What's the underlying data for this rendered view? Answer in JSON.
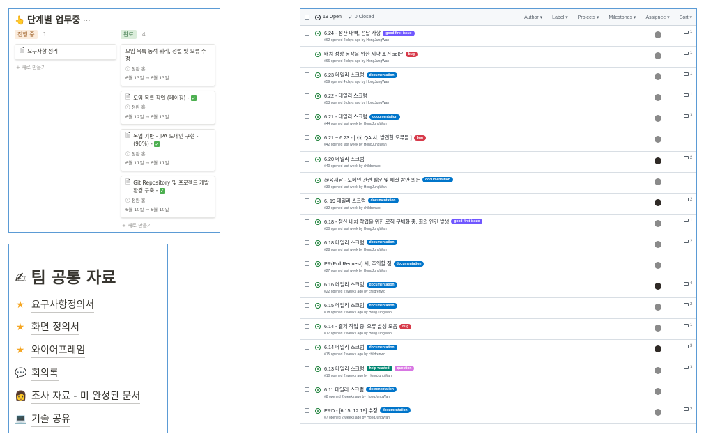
{
  "kanban": {
    "title": "단계별 업무중",
    "title_icon": "pointer-hand-icon",
    "more": "···",
    "columns": [
      {
        "tag": "진행 중",
        "count": "1",
        "cards": [
          {
            "title": "요구사항 정리",
            "done": false
          }
        ],
        "new_label": "+ 새로 만들기"
      },
      {
        "tag": "완료",
        "count": "4",
        "cards": [
          {
            "title": "모임 목록 동적 쿼리, 정렬 및 오류 수정",
            "person": "정완 홍",
            "dates": "6월 13일 → 6월 13일",
            "done": false,
            "has_icon": false
          },
          {
            "title": "모임 목록 작업 (페이징) -",
            "person": "정완 홍",
            "dates": "6월 12일 → 6월 13일",
            "done": true,
            "has_icon": true
          },
          {
            "title": "목업 기반 - JPA 도메인 구현 - (90%) -",
            "person": "정완 홍",
            "dates": "6월 11일 → 6월 11일",
            "done": true,
            "has_icon": true
          },
          {
            "title": "Git Repository 및 프로젝트 개발 환경 구축 -",
            "person": "정완 홍",
            "dates": "6월 10일 → 6월 10일",
            "done": true,
            "has_icon": true
          }
        ],
        "new_label": "+ 새로 만들기"
      }
    ]
  },
  "team": {
    "title": "팀 공통 자료",
    "title_icon": "writing-hand-icon",
    "items": [
      {
        "label": "요구사항정의서",
        "icon": "star-icon"
      },
      {
        "label": "화면 정의서",
        "icon": "star-icon"
      },
      {
        "label": "와이어프레임",
        "icon": "star-icon"
      },
      {
        "label": "회의록",
        "icon": "speech-bubble-icon"
      },
      {
        "label": "조사 자료 - 미 완성된 문서",
        "icon": "person-at-desk-icon"
      },
      {
        "label": "기술 공유",
        "icon": "laptop-icon"
      }
    ]
  },
  "issues": {
    "open_label": "19 Open",
    "closed_label": "0 Closed",
    "filters": [
      "Author ▾",
      "Label ▾",
      "Projects ▾",
      "Milestones ▾",
      "Assignee ▾",
      "Sort ▾"
    ],
    "label_colors": {
      "good first issue": "#7057ff",
      "bug": "#d73a4a",
      "documentation": "#0075ca",
      "help wanted": "#008672",
      "question": "#d876e3"
    },
    "rows": [
      {
        "title": "6.24 - 정산 내역, 전달 사항",
        "labels": [
          "good first issue"
        ],
        "sub": "#62 opened 2 days ago by HongJungWan",
        "comments": "1",
        "avatar_dark": false
      },
      {
        "title": "배치 정상 동작을 위한 제약 조건 sql문",
        "labels": [
          "bug"
        ],
        "sub": "#66 opened 2 days ago by HongJungWan",
        "comments": "1",
        "avatar_dark": false
      },
      {
        "title": "6.23 데일리 스크럼",
        "labels": [
          "documentation"
        ],
        "sub": "#59 opened 4 days ago by HongJungWan",
        "comments": "1",
        "avatar_dark": false
      },
      {
        "title": "6.22 - 데일리 스크럼",
        "labels": [],
        "sub": "#53 opened 5 days ago by HongJungWan",
        "comments": "1",
        "avatar_dark": false
      },
      {
        "title": "6.21 - 데일리 스크럼",
        "labels": [
          "documentation"
        ],
        "sub": "#44 opened last week by HongJungWan",
        "comments": "3",
        "avatar_dark": false
      },
      {
        "title": "6.21 ~ 6.23 - [ 👀 QA 시, 발견한 오류들 ]",
        "labels": [
          "bug"
        ],
        "sub": "#42 opened last week by HongJungWan",
        "comments": "",
        "avatar_dark": false
      },
      {
        "title": "6.20 데일리 스크럼",
        "labels": [],
        "sub": "#40 opened last week by childrenwo",
        "comments": "2",
        "avatar_dark": true
      },
      {
        "title": "@육재남 - 도메인 관련 질문 및 해결 방안 의논",
        "labels": [
          "documentation"
        ],
        "sub": "#39 opened last week by HongJungWan",
        "comments": "",
        "avatar_dark": false
      },
      {
        "title": "6. 19 데일리 스크럼",
        "labels": [
          "documentation"
        ],
        "sub": "#32 opened last week by childrenwo",
        "comments": "2",
        "avatar_dark": true
      },
      {
        "title": "6.18 - 정산 배치 작업을 위한 로직 구체화 중, 회의 안건 발생",
        "labels": [
          "good first issue"
        ],
        "sub": "#30 opened last week by HongJungWan",
        "comments": "1",
        "avatar_dark": false
      },
      {
        "title": "6.18 데일리 스크럼",
        "labels": [
          "documentation"
        ],
        "sub": "#28 opened last week by HongJungWan",
        "comments": "2",
        "avatar_dark": false
      },
      {
        "title": "PR(Pull Request) 시, 주의할 점",
        "labels": [
          "documentation"
        ],
        "sub": "#27 opened last week by HongJungWan",
        "comments": "",
        "avatar_dark": false
      },
      {
        "title": "6.16 데일리 스크럼",
        "labels": [
          "documentation"
        ],
        "sub": "#22 opened 2 weeks ago by childrenwo",
        "comments": "4",
        "avatar_dark": true
      },
      {
        "title": "6.15 데일리 스크럼",
        "labels": [
          "documentation"
        ],
        "sub": "#18 opened 2 weeks ago by HongJungWan",
        "comments": "2",
        "avatar_dark": false
      },
      {
        "title": "6.14 - 결제 작업 중, 오류 발생 모음",
        "labels": [
          "bug"
        ],
        "sub": "#17 opened 2 weeks ago by HongJungWan",
        "comments": "1",
        "avatar_dark": false
      },
      {
        "title": "6.14 데일리 스크럼",
        "labels": [
          "documentation"
        ],
        "sub": "#15 opened 2 weeks ago by childrenwo",
        "comments": "3",
        "avatar_dark": true
      },
      {
        "title": "6.13 데일리 스크럼",
        "labels": [
          "help wanted",
          "question"
        ],
        "sub": "#10 opened 2 weeks ago by HongJungWan",
        "comments": "3",
        "avatar_dark": false
      },
      {
        "title": "6.11 데일리 스크럼",
        "labels": [
          "documentation"
        ],
        "sub": "#8 opened 2 weeks ago by HongJungWan",
        "comments": "",
        "avatar_dark": false
      },
      {
        "title": "ERD - [6.15, 12:19] 수정",
        "labels": [
          "documentation"
        ],
        "sub": "#7 opened 2 weeks ago by HongJungWan",
        "comments": "2",
        "avatar_dark": false
      }
    ]
  }
}
